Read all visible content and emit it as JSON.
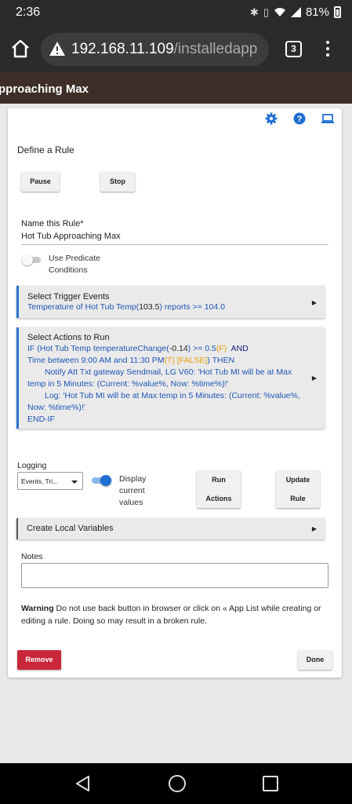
{
  "status_bar": {
    "time": "2:36",
    "battery": "81%"
  },
  "browser": {
    "url_host": "192.168.11.109",
    "url_path": "/installedapp",
    "tab_count": "3"
  },
  "header": {
    "title": "pproaching Max"
  },
  "rule": {
    "section_title": "Define a Rule",
    "pause_label": "Pause",
    "stop_label": "Stop",
    "name_label": "Name this Rule*",
    "name_value": "Hot Tub Approaching Max",
    "predicate_label_1": "Use Predicate",
    "predicate_label_2": "Conditions",
    "trigger": {
      "title": "Select Trigger Events",
      "text_1": "Temperature of Hot Tub Temp(",
      "value": "103.5",
      "text_2": ") reports >= 104.0"
    },
    "actions": {
      "title": "Select Actions to Run",
      "l1_a": "IF (Hot Tub Temp temperatureChange(",
      "l1_val": "-0.14",
      "l1_b": ") >= 0.5",
      "l1_f": "(F)",
      "l1_and": "AND",
      "l2_a": "Time between 9:00 AM and 11:30 PM",
      "l2_t": "(T)",
      "l2_false": "[FALSE]",
      "l2_b": ") THEN",
      "l3": "Notify Att Txt gateway Sendmail, LG V60: 'Hot Tub MI will be at Max",
      "l4": "temp in 5 Minutes: (Current: %value%, Now: %time%)!'",
      "l5": "Log: 'Hot Tub MI will be at Max temp in 5 Minutes: (Current: %value%,",
      "l6": "Now: %time%)!'",
      "l7": "END-IF"
    },
    "logging_label": "Logging",
    "logging_value": "Events, Tri...",
    "display_label_1": "Display",
    "display_label_2": "current",
    "display_label_3": "values",
    "run_label_1": "Run",
    "run_label_2": "Actions",
    "update_label_1": "Update",
    "update_label_2": "Rule",
    "local_vars_title": "Create Local Variables",
    "notes_label": "Notes",
    "notes_value": "",
    "warning_bold": "Warning",
    "warning_text_1": " Do not use back button in browser or click on « App List while creating or",
    "warning_text_2": "editing a rule. Doing so may result in a broken rule.",
    "remove_label": "Remove",
    "done_label": "Done"
  },
  "colors": {
    "accent_blue": "#1f55b5",
    "panel_border": "#2f72c8",
    "remove_red": "#c9283a",
    "orange": "#e6a000",
    "header_brown": "#3d2e28"
  }
}
